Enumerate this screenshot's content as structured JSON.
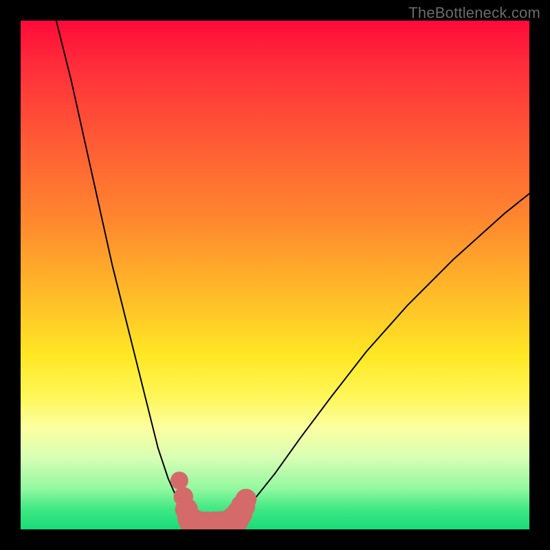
{
  "watermark": "TheBottleneck.com",
  "colors": {
    "frame": "#000000",
    "curve": "#000000",
    "marker": "#d46a6a",
    "gradient_stops": [
      "#ff0a3a",
      "#ff2a3a",
      "#ff5636",
      "#ff8a2e",
      "#ffc328",
      "#ffe824",
      "#fff75a",
      "#fbffa0",
      "#d7ffb4",
      "#93f8a0",
      "#3fe884",
      "#18db78"
    ]
  },
  "chart_data": {
    "type": "line",
    "title": "",
    "xlabel": "",
    "ylabel": "",
    "xlim": [
      0,
      100
    ],
    "ylim": [
      0,
      100
    ],
    "grid": false,
    "legend": false,
    "series": [
      {
        "name": "left-branch",
        "x": [
          7,
          10,
          14,
          18,
          22,
          25,
          27,
          29,
          31,
          32.5,
          33.5,
          34.2
        ],
        "y": [
          100,
          88,
          70,
          52,
          36,
          24,
          16,
          10,
          5.5,
          3,
          1.6,
          0.8
        ]
      },
      {
        "name": "right-branch",
        "x": [
          41,
          43,
          46,
          50,
          55,
          61,
          68,
          76,
          85,
          95,
          100
        ],
        "y": [
          0.8,
          2.5,
          6,
          11,
          18,
          26,
          35,
          44,
          53,
          62,
          66
        ]
      },
      {
        "name": "trough-floor",
        "x": [
          34.2,
          36,
          38,
          40,
          41
        ],
        "y": [
          0.8,
          0.5,
          0.5,
          0.6,
          0.8
        ]
      }
    ],
    "markers": {
      "name": "highlight-dots",
      "color": "#d46a6a",
      "points": [
        {
          "x": 31.2,
          "y": 9.6,
          "r": 1.1
        },
        {
          "x": 32.0,
          "y": 6.4,
          "r": 1.2
        },
        {
          "x": 32.6,
          "y": 3.9,
          "r": 1.4
        },
        {
          "x": 33.2,
          "y": 2.2,
          "r": 1.5
        },
        {
          "x": 34.0,
          "y": 1.2,
          "r": 1.7
        },
        {
          "x": 35.2,
          "y": 0.7,
          "r": 1.8
        },
        {
          "x": 36.6,
          "y": 0.55,
          "r": 1.85
        },
        {
          "x": 38.0,
          "y": 0.55,
          "r": 1.85
        },
        {
          "x": 39.3,
          "y": 0.62,
          "r": 1.85
        },
        {
          "x": 40.4,
          "y": 0.78,
          "r": 1.8
        },
        {
          "x": 41.3,
          "y": 1.2,
          "r": 1.75
        },
        {
          "x": 42.2,
          "y": 2.0,
          "r": 1.7
        },
        {
          "x": 43.0,
          "y": 3.1,
          "r": 1.6
        },
        {
          "x": 43.7,
          "y": 4.5,
          "r": 1.5
        },
        {
          "x": 44.3,
          "y": 5.9,
          "r": 1.3
        }
      ]
    }
  }
}
